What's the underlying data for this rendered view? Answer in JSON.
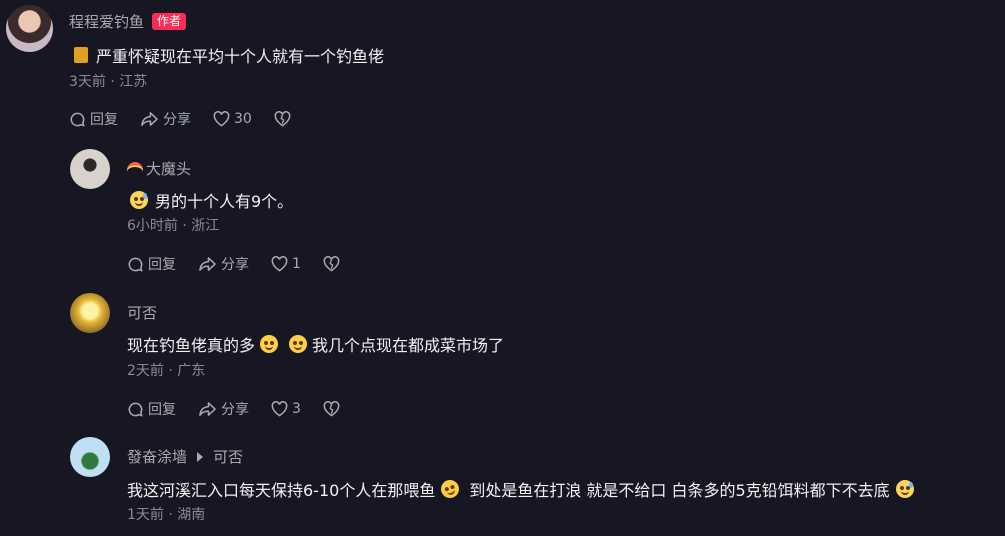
{
  "comments": [
    {
      "username": "程程爱钓鱼",
      "badge": "作者",
      "text": "严重怀疑现在平均十个人就有一个钓鱼佬",
      "meta": "3天前 · 江苏",
      "reply_label": "回复",
      "share_label": "分享",
      "likes": "30"
    },
    {
      "username": "大魔头",
      "text": "男的十个人有9个。",
      "meta": "6小时前 · 浙江",
      "reply_label": "回复",
      "share_label": "分享",
      "likes": "1"
    },
    {
      "username": "可否",
      "text_part1": "现在钓鱼佬真的多",
      "text_part2": "我几个点现在都成菜市场了",
      "meta": "2天前 · 广东",
      "reply_label": "回复",
      "share_label": "分享",
      "likes": "3"
    },
    {
      "username": "發奋涂墙",
      "reply_to": "可否",
      "text_part1": "我这河溪汇入口每天保持6-10个人在那喂鱼",
      "text_part2": "到处是鱼在打浪 就是不给口 白条多的5克铅饵料都下不去底",
      "meta": "1天前 · 湖南"
    }
  ]
}
